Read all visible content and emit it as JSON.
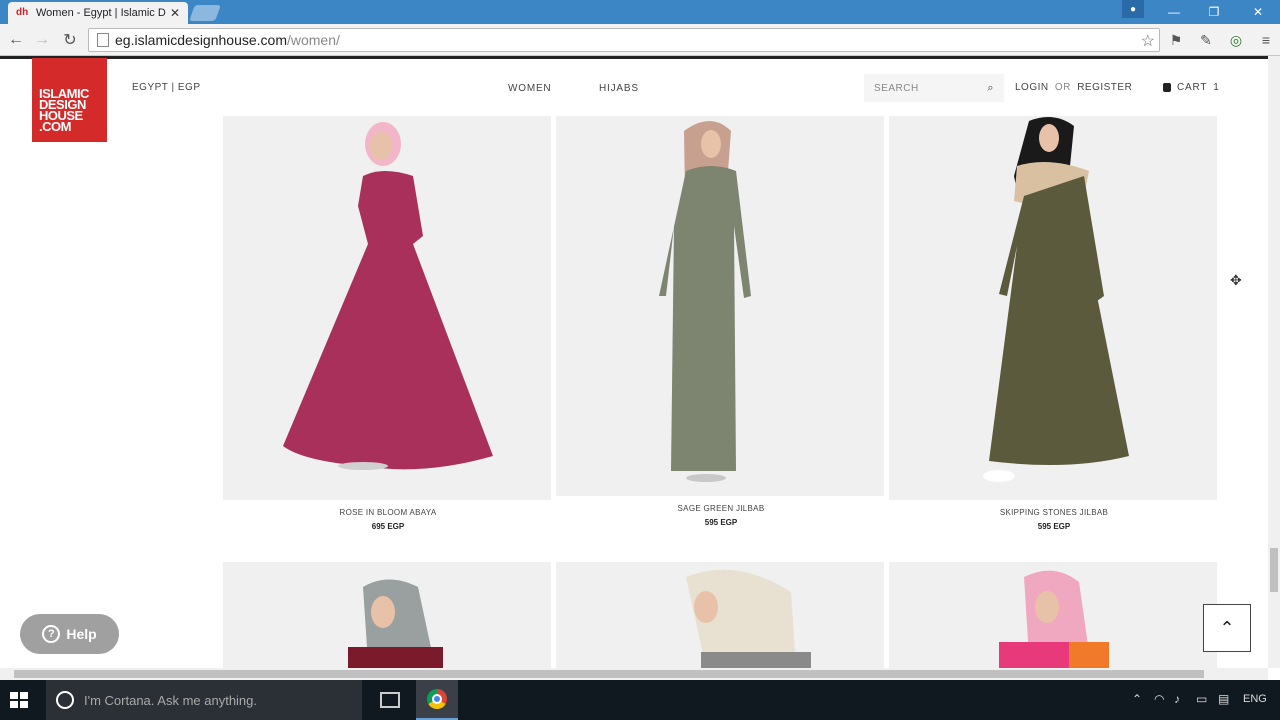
{
  "browser": {
    "tab_title": "Women - Egypt | Islamic D",
    "tab_favicon": "dh",
    "tab_close": "✕",
    "url_host": "eg.islamicdesignhouse.com",
    "url_path": "/women/",
    "window_controls": {
      "minimize": "—",
      "maximize": "❐",
      "close": "✕"
    }
  },
  "site": {
    "logo_lines": [
      "ISLAMIC",
      "DESIGN",
      "HOUSE",
      ".COM"
    ],
    "currency": "EGYPT | EGP",
    "nav": {
      "women": "WOMEN",
      "hijabs": "HIJABS"
    },
    "search_placeholder": "SEARCH",
    "login": "LOGIN",
    "or": "OR",
    "register": "REGISTER",
    "cart_label": "CART",
    "cart_count": "1"
  },
  "products": [
    {
      "name": "ROSE IN BLOOM ABAYA",
      "price": "695 EGP",
      "color": "#a8305a"
    },
    {
      "name": "SAGE GREEN JILBAB",
      "price": "595 EGP",
      "color": "#7d8470"
    },
    {
      "name": "SKIPPING STONES JILBAB",
      "price": "595 EGP",
      "color": "#5b5a3c"
    }
  ],
  "products_row2_colors": [
    "#9aa0a0",
    "#e8e0d0",
    "#e86a9a"
  ],
  "widgets": {
    "help": "Help",
    "help_icon": "?",
    "to_top": "⌃"
  },
  "taskbar": {
    "cortana": "I'm Cortana. Ask me anything.",
    "lang": "ENG"
  }
}
